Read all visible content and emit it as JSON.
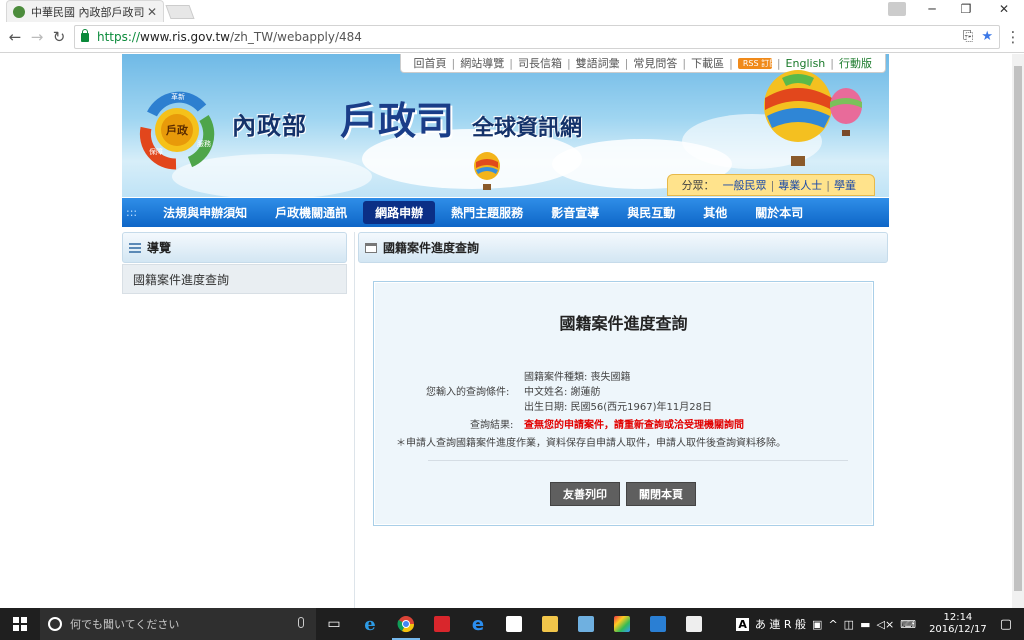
{
  "browser": {
    "tab_title": "中華民國 內政部戶政司 全",
    "url_secure": "https://",
    "url_host": "www.ris.gov.tw",
    "url_path": "/zh_TW/webapply/484"
  },
  "top_links": [
    "回首頁",
    "網站導覽",
    "司長信箱",
    "雙語詞彙",
    "常見問答",
    "下載區",
    "English",
    "行動版"
  ],
  "rss_label": "RSS 訂閱",
  "logo": {
    "top": "革新",
    "center": "戶政",
    "left": "保障",
    "right": "服務"
  },
  "site_title": {
    "dept": "內政部",
    "name": "戶政司",
    "suffix": "全球資訊網"
  },
  "audience": {
    "label": "分眾：",
    "items": [
      "一般民眾",
      "專業人士",
      "學童"
    ]
  },
  "nav": {
    "items": [
      "法規與申辦須知",
      "戶政機關通訊",
      "網路申辦",
      "熱門主題服務",
      "影音宣導",
      "與民互動",
      "其他",
      "關於本司"
    ],
    "active_index": 2
  },
  "left_menu": {
    "header": "導覽",
    "items": [
      "國籍案件進度查詢"
    ]
  },
  "main": {
    "header": "國籍案件進度查詢",
    "panel_title": "國籍案件進度查詢",
    "case_type": "國籍案件種類: 喪失國籍",
    "query_label": "您輸入的查詢條件:",
    "query_name": "中文姓名: 謝蓮舫",
    "query_birth": "出生日期: 民國56(西元1967)年11月28日",
    "result_label": "查詢結果:",
    "result_value": "查無您的申請案件，請重新查詢或洽受理機關詢問",
    "note": "＊申請人查詢國籍案件進度作業，資料保存自申請人取件，申請人取件後查詢資料移除。",
    "print_button": "友善列印",
    "close_button": "關閉本頁"
  },
  "taskbar": {
    "search_placeholder": "何でも聞いてください",
    "ime": "あ 連 R 般",
    "time": "12:14",
    "date": "2016/12/17"
  },
  "colors": {
    "nav_blue": "#0e66c7",
    "nav_active": "#0b2f86",
    "result_red": "#e20000",
    "panel_bg": "#eef6fb"
  }
}
